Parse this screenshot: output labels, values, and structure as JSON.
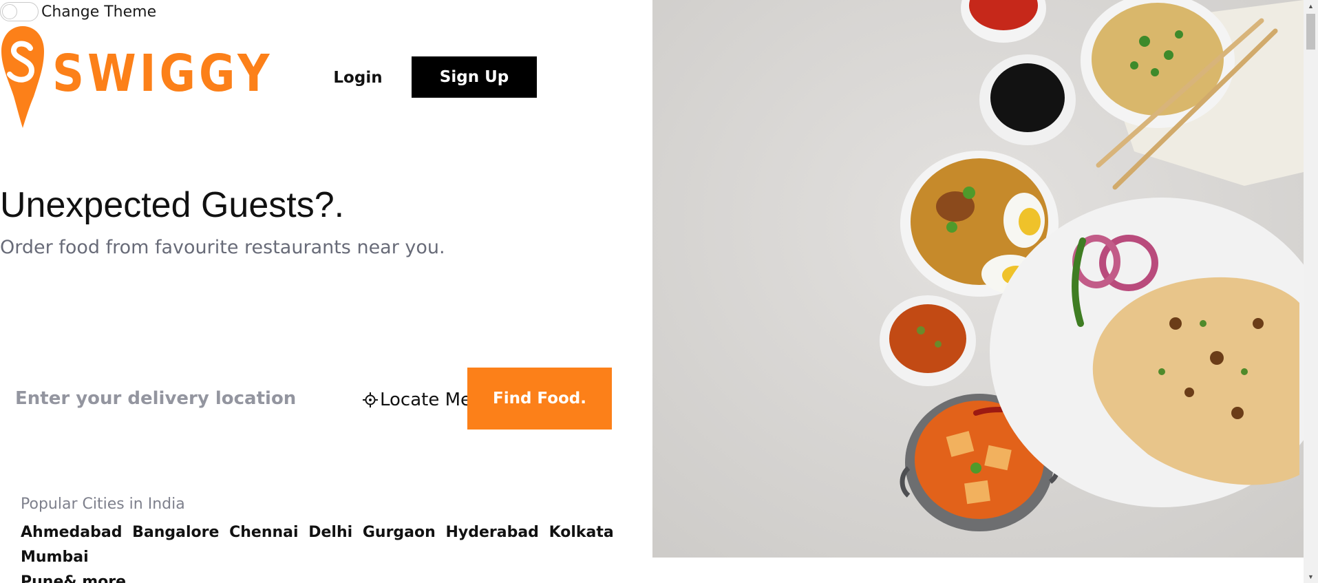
{
  "theme": {
    "label": "Change Theme"
  },
  "brand": {
    "name": "SWIGGY",
    "accent": "#fc8019"
  },
  "auth": {
    "login_label": "Login",
    "signup_label": "Sign Up"
  },
  "hero": {
    "title": "Unexpected Guests?.",
    "subtitle": "Order food from favourite restaurants near you."
  },
  "search": {
    "placeholder": "Enter your delivery location",
    "value": "",
    "locate_label": "Locate Me",
    "locate_icon": "crosshair-icon",
    "find_label": "Find Food."
  },
  "cities": {
    "heading": "Popular Cities in India",
    "items": [
      "Ahmedabad",
      "Bangalore",
      "Chennai",
      "Delhi",
      "Gurgaon",
      "Hyderabad",
      "Kolkata",
      "Mumbai",
      "Pune"
    ],
    "more": "& more."
  },
  "colors": {
    "cta": "#fc8019",
    "signup_bg": "#000000",
    "subtitle": "#686b78",
    "muted": "#7e808c"
  }
}
